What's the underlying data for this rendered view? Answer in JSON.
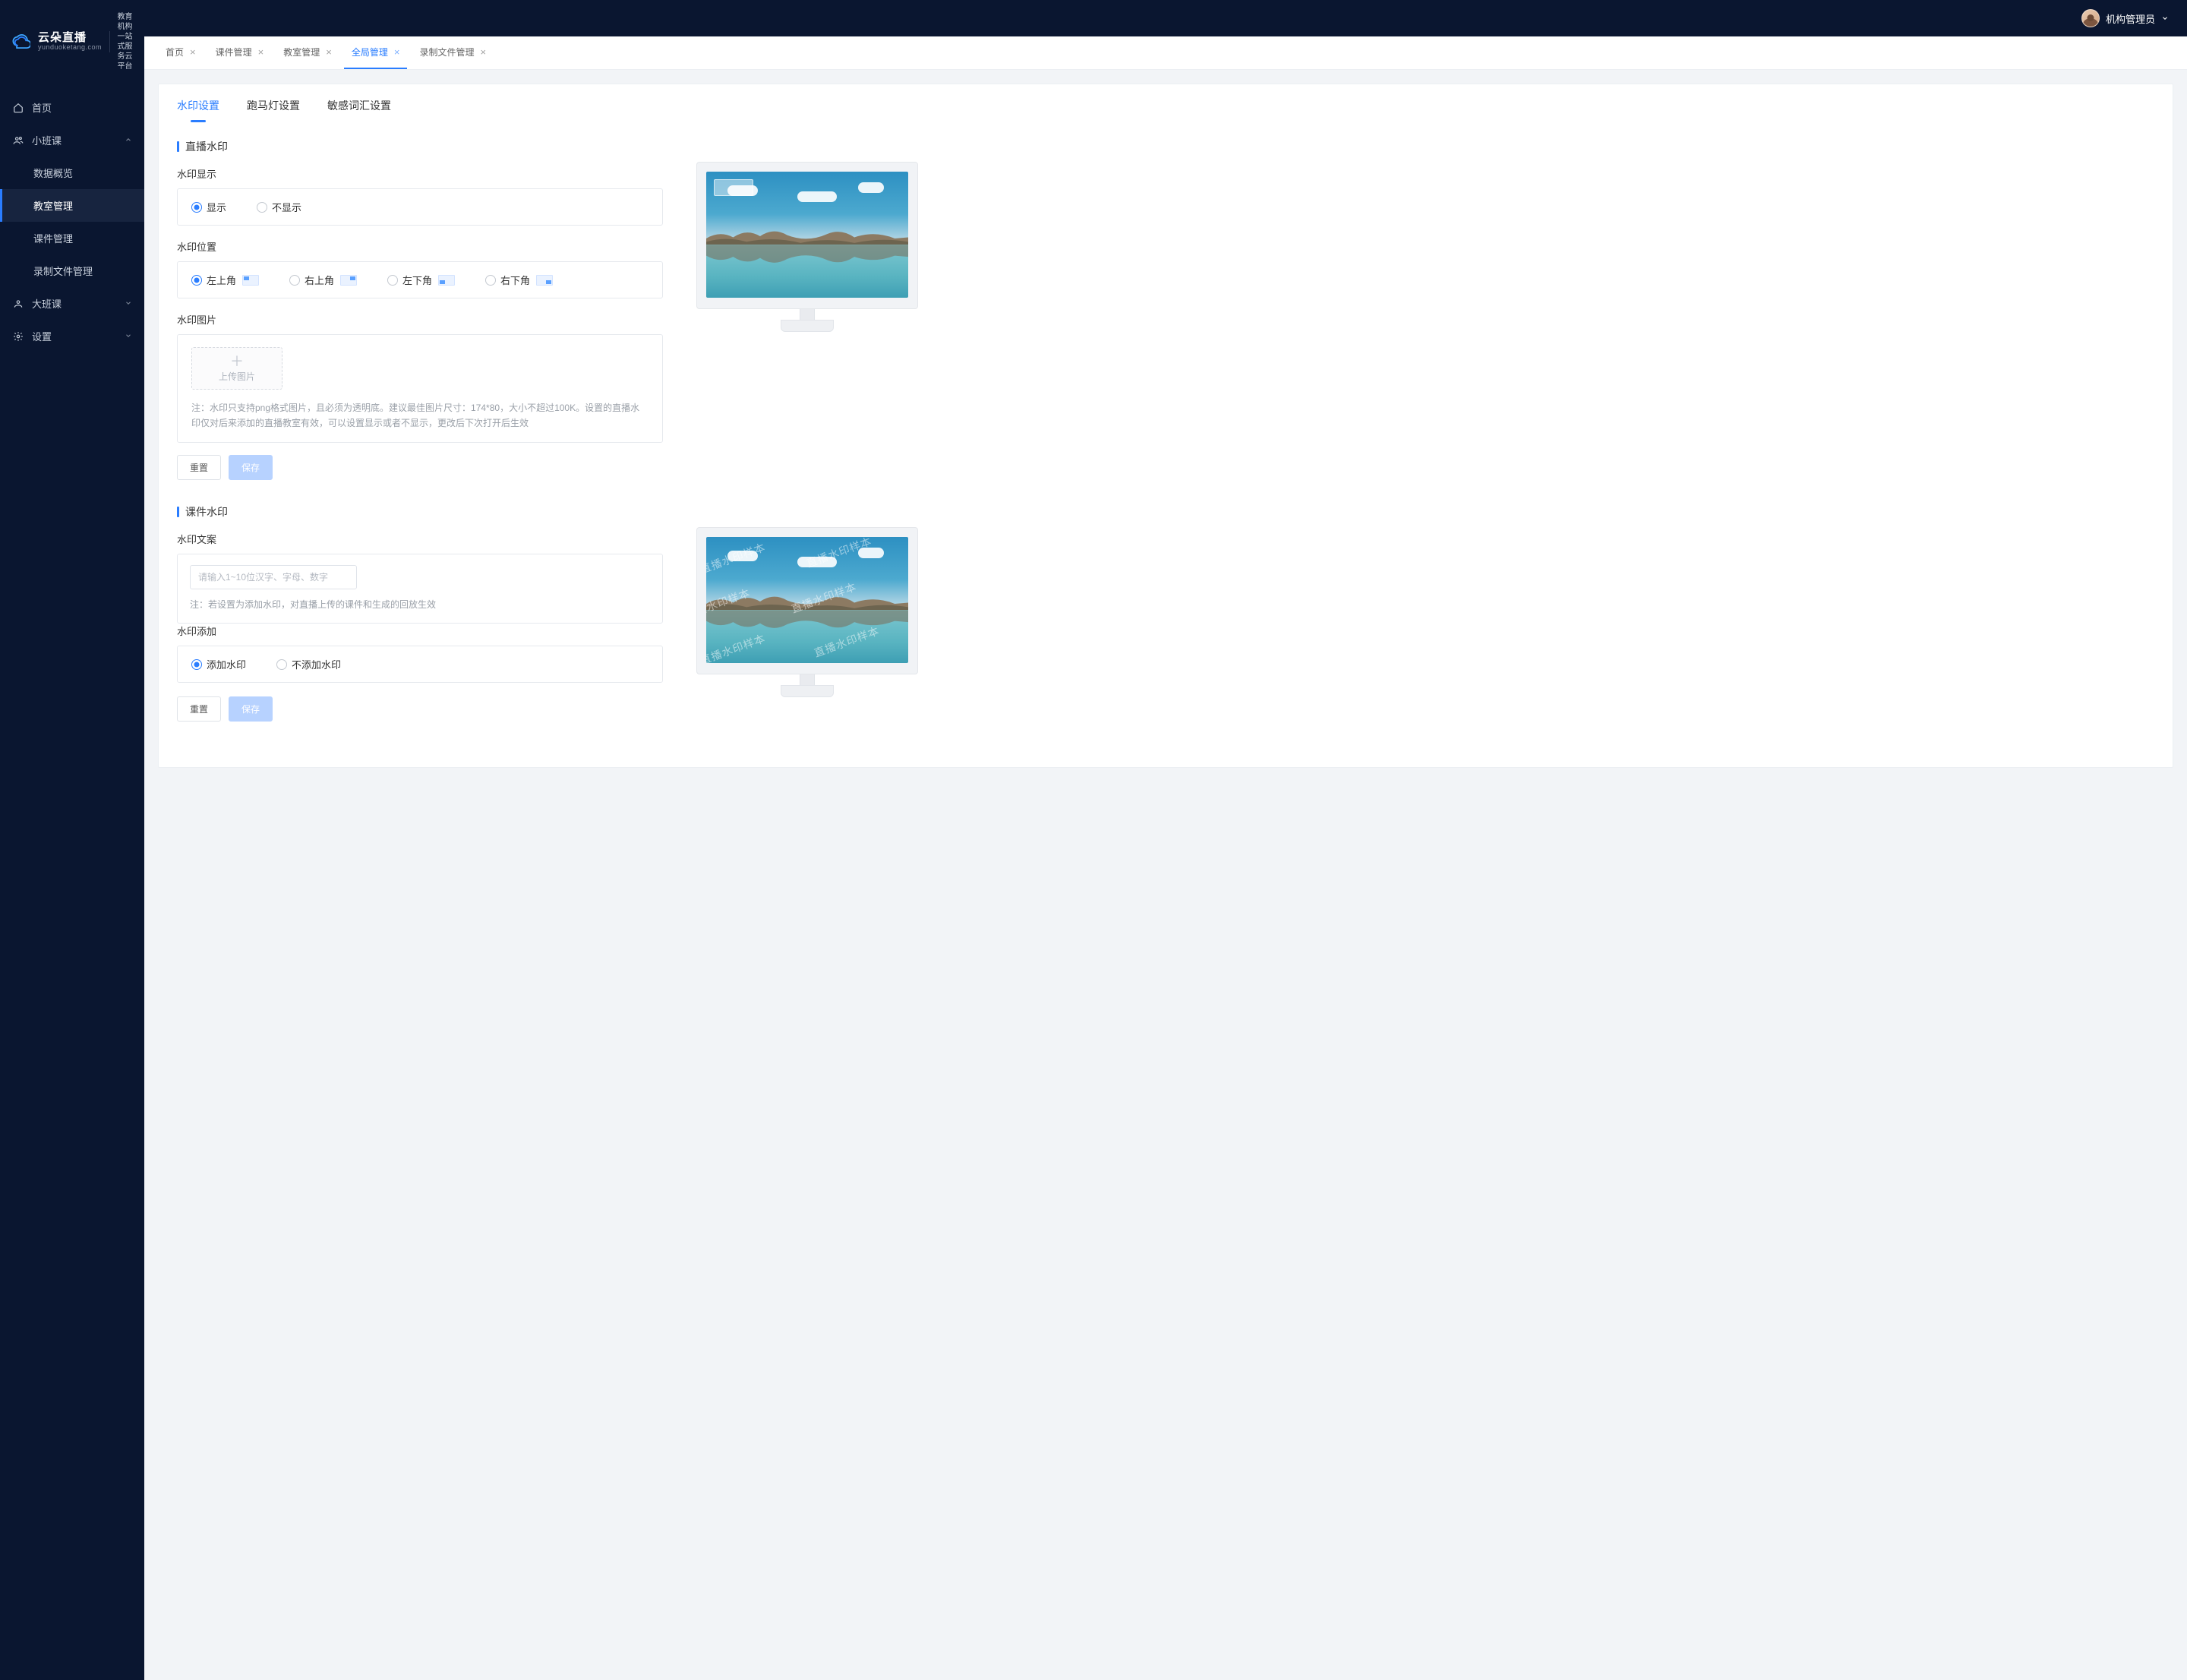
{
  "brand": {
    "name": "云朵直播",
    "domain": "yunduoketang.com",
    "tagline_l1": "教育机构一站",
    "tagline_l2": "式服务云平台"
  },
  "user": {
    "name": "机构管理员"
  },
  "sidebar": {
    "home": "首页",
    "small_class": "小班课",
    "items": {
      "data_overview": "数据概览",
      "classroom": "教室管理",
      "courseware": "课件管理",
      "recording": "录制文件管理"
    },
    "big_class": "大班课",
    "settings": "设置"
  },
  "tabs": [
    {
      "label": "首页",
      "closable": true,
      "active": false
    },
    {
      "label": "课件管理",
      "closable": true,
      "active": false
    },
    {
      "label": "教室管理",
      "closable": true,
      "active": false
    },
    {
      "label": "全局管理",
      "closable": true,
      "active": true
    },
    {
      "label": "录制文件管理",
      "closable": true,
      "active": false
    }
  ],
  "page_tabs": {
    "watermark": "水印设置",
    "marquee": "跑马灯设置",
    "sensitive": "敏感词汇设置"
  },
  "live_wm": {
    "section": "直播水印",
    "display_label": "水印显示",
    "display_show": "显示",
    "display_hide": "不显示",
    "position_label": "水印位置",
    "pos_tl": "左上角",
    "pos_tr": "右上角",
    "pos_bl": "左下角",
    "pos_br": "右下角",
    "image_label": "水印图片",
    "upload_text": "上传图片",
    "hint": "注：水印只支持png格式图片，且必须为透明底。建议最佳图片尺寸：174*80，大小不超过100K。设置的直播水印仅对后来添加的直播教室有效，可以设置显示或者不显示，更改后下次打开后生效",
    "reset": "重置",
    "save": "保存"
  },
  "course_wm": {
    "section": "课件水印",
    "text_label": "水印文案",
    "text_placeholder": "请输入1~10位汉字、字母、数字",
    "text_hint": "注：若设置为添加水印，对直播上传的课件和生成的回放生效",
    "add_label": "水印添加",
    "add_yes": "添加水印",
    "add_no": "不添加水印",
    "reset": "重置",
    "save": "保存",
    "sample_text": "直播水印样本"
  }
}
